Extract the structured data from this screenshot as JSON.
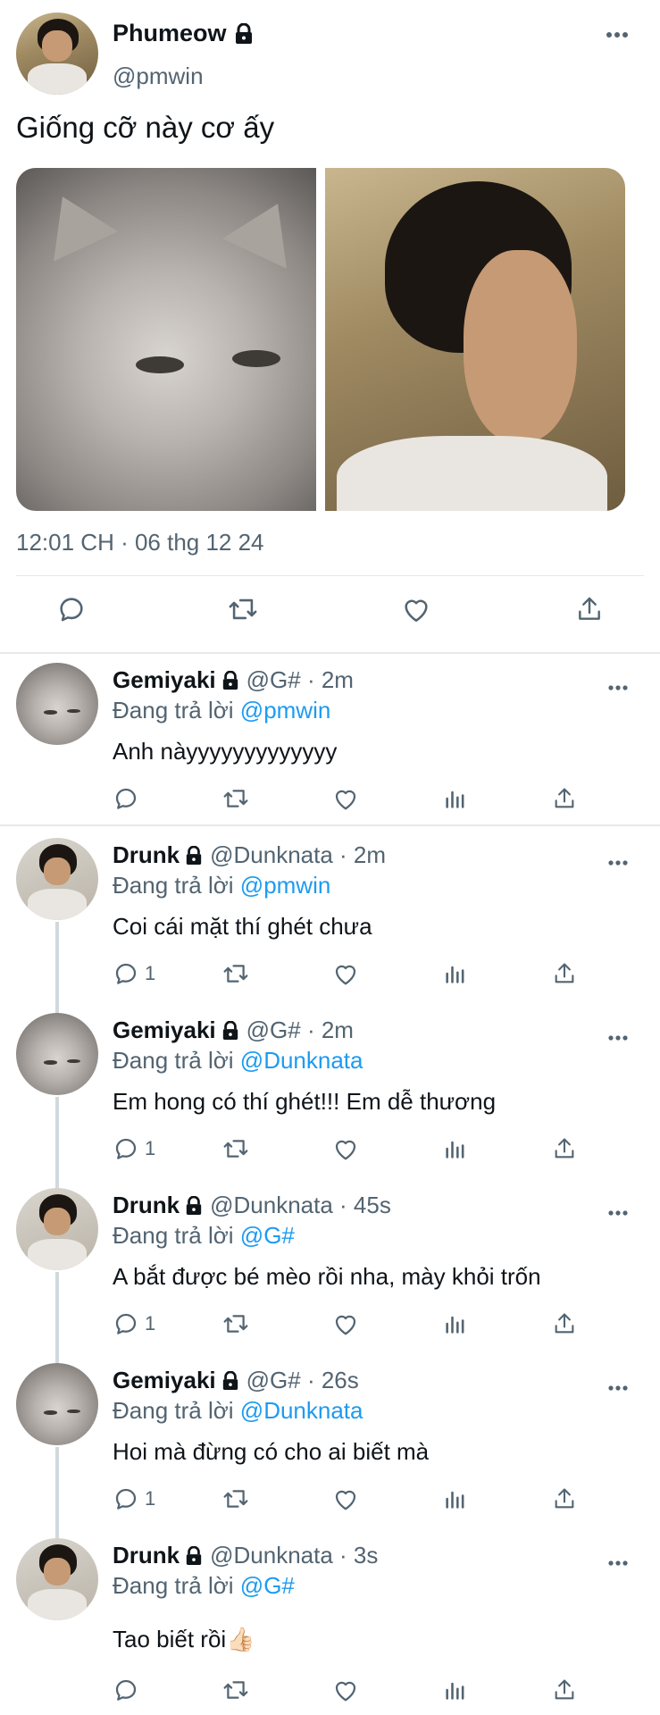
{
  "main_tweet": {
    "display_name": "Phumeow",
    "handle": "@pmwin",
    "text": "Giống cỡ này cơ ấy",
    "timestamp": "12:01 CH · 06 thg 12 24",
    "media": [
      "cat-photo",
      "man-photo"
    ]
  },
  "replies": [
    {
      "name": "Gemiyaki",
      "meta": "@G# · 2m",
      "replying_prefix": "Đang trả lời",
      "replying_to": "@pmwin",
      "text": "Anh nàyyyyyyyyyyyyy",
      "reply_count": "",
      "avatar": "cat"
    },
    {
      "name": "Drunk",
      "meta": "@Dunknata · 2m",
      "replying_prefix": "Đang trả lời",
      "replying_to": "@pmwin",
      "text": "Coi cái mặt thí ghét chưa",
      "reply_count": "1",
      "avatar": "person"
    },
    {
      "name": "Gemiyaki",
      "meta": "@G# · 2m",
      "replying_prefix": "Đang trả lời",
      "replying_to": "@Dunknata",
      "text": "Em hong có thí ghét!!! Em dễ thương",
      "reply_count": "1",
      "avatar": "cat"
    },
    {
      "name": "Drunk",
      "meta": "@Dunknata · 45s",
      "replying_prefix": "Đang trả lời",
      "replying_to": "@G#",
      "text": "A bắt được bé mèo rồi nha, mày khỏi trốn",
      "reply_count": "1",
      "avatar": "person"
    },
    {
      "name": "Gemiyaki",
      "meta": "@G# · 26s",
      "replying_prefix": "Đang trả lời",
      "replying_to": "@Dunknata",
      "text": "Hoi mà đừng có cho ai biết mà",
      "reply_count": "1",
      "avatar": "cat"
    },
    {
      "name": "Drunk",
      "meta": "@Dunknata · 3s",
      "replying_prefix": "Đang trả lời",
      "replying_to": "@G#",
      "text": "Tao biết rồi👍🏻",
      "reply_count": "",
      "avatar": "person"
    }
  ],
  "colors": {
    "accent": "#1d9bf0",
    "muted": "#536471",
    "text": "#0f1419"
  }
}
